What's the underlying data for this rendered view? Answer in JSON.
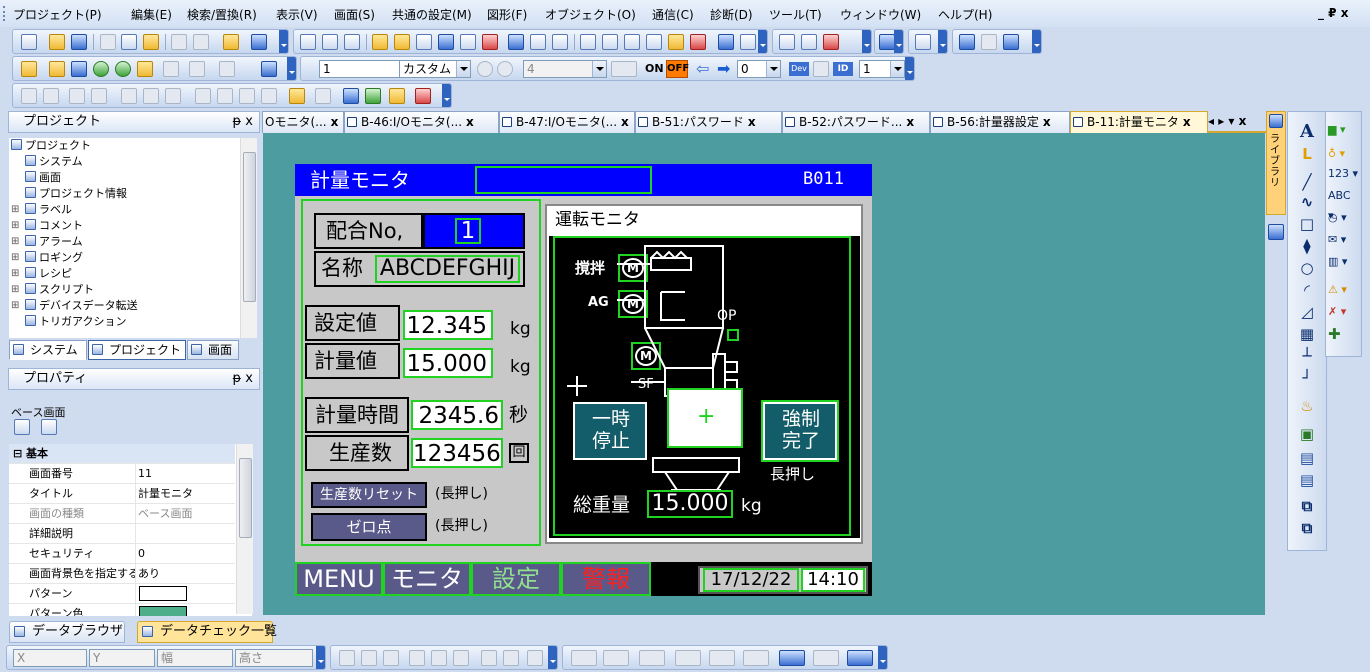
{
  "menu": [
    "プロジェクト(P)",
    "編集(E)",
    "検索/置換(R)",
    "表示(V)",
    "画面(S)",
    "共通の設定(M)",
    "図形(F)",
    "オブジェクト(O)",
    "通信(C)",
    "診断(D)",
    "ツール(T)",
    "ウィンドウ(W)",
    "ヘルプ(H)"
  ],
  "window_controls": "_ ₽ x",
  "toolbar": {
    "line_width": "1",
    "line_style": "カスタム",
    "zoom_value": "4",
    "on_label": "ON",
    "off_label": "OFF",
    "shift_value": "0",
    "dev_label": "Dev",
    "id_label": "ID",
    "id_value": "1"
  },
  "project_panel": {
    "title": "プロジェクト",
    "pin": "ᵽ x",
    "tree": [
      {
        "label": "プロジェクト",
        "indent": 0
      },
      {
        "label": "システム",
        "indent": 1
      },
      {
        "label": "画面",
        "indent": 1
      },
      {
        "label": "プロジェクト情報",
        "indent": 1
      },
      {
        "label": "ラベル",
        "indent": 1
      },
      {
        "label": "コメント",
        "indent": 1
      },
      {
        "label": "アラーム",
        "indent": 1
      },
      {
        "label": "ロギング",
        "indent": 1
      },
      {
        "label": "レシピ",
        "indent": 1
      },
      {
        "label": "スクリプト",
        "indent": 1
      },
      {
        "label": "デバイスデータ転送",
        "indent": 1
      },
      {
        "label": "トリガアクション",
        "indent": 1
      }
    ],
    "tabs": [
      "システム",
      "プロジェクト",
      "画面"
    ]
  },
  "property_panel": {
    "title": "プロパティ",
    "pin": "ᵽ x",
    "object_label": "ベース画面",
    "category": "基本",
    "rows": [
      {
        "key": "画面番号",
        "value": "11",
        "gray": false
      },
      {
        "key": "タイトル",
        "value": "計量モニタ",
        "gray": false
      },
      {
        "key": "画面の種類",
        "value": "ベース画面",
        "gray": true
      },
      {
        "key": "詳細説明",
        "value": "",
        "gray": false
      },
      {
        "key": "セキュリティ",
        "value": "0",
        "gray": false
      },
      {
        "key": "画面背景色を指定する",
        "value": "あり",
        "gray": false
      },
      {
        "key": "パターン",
        "value": "",
        "gray": false
      },
      {
        "key": "パターン色",
        "value": "",
        "gray": false
      }
    ]
  },
  "bottom_tabs": [
    "データブラウザ",
    "データチェック一覧"
  ],
  "status_toolbar": {
    "x": "X",
    "y": "Y",
    "w": "幅",
    "h": "高さ"
  },
  "doc_tabs": [
    {
      "label": "Oモニタ(...",
      "active": false
    },
    {
      "label": "B-46:I/Oモニタ(...",
      "active": false
    },
    {
      "label": "B-47:I/Oモニタ(...",
      "active": false
    },
    {
      "label": "B-51:パスワード",
      "active": false
    },
    {
      "label": "B-52:パスワード...",
      "active": false
    },
    {
      "label": "B-56:計量器設定",
      "active": false
    },
    {
      "label": "B-11:計量モニタ",
      "active": true
    }
  ],
  "doc_tab_nav": "◂ ▸ ▾ x",
  "library_label": "ライブラリ",
  "screen": {
    "title": "計量モニタ",
    "screen_id": "B011",
    "blend_label": "配合No,",
    "blend_value": "1",
    "name_label": "名称",
    "name_value": "ABCDEFGHIJ",
    "setpoint_label": "設定値",
    "setpoint_value": "12.345",
    "measured_label": "計量値",
    "measured_value": "15.000",
    "unit_kg": "kg",
    "time_label": "計量時間",
    "time_value": "2345.6",
    "time_unit": "秒",
    "count_label": "生産数",
    "count_value": "123456",
    "count_unit": "回",
    "reset_btn": "生産数リセット",
    "zero_btn": "ゼロ点",
    "long_press": "(長押し)",
    "op_title": "運転モニタ",
    "stir_label": "撹拌",
    "ag_label": "AG",
    "op_label": "OP",
    "sf_label": "SF",
    "m": "M",
    "pause_btn": "一時停止",
    "force_btn": "強制完了",
    "long_press2": "長押し",
    "total_label": "総重量",
    "total_value": "15.000",
    "total_unit": "kg",
    "nav": [
      "MENU",
      "モニタ",
      "設定",
      "警報"
    ],
    "date": "17/12/22",
    "time": "14:10"
  },
  "colors": {
    "accent_green": "#21d321",
    "screen_blue": "#0000ff",
    "work_bg": "#4d9da0"
  }
}
